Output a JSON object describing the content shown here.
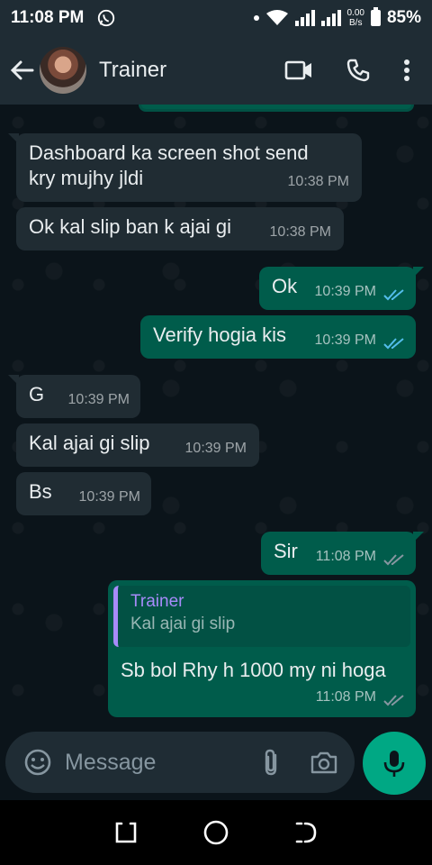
{
  "status": {
    "time": "11:08 PM",
    "net_speed_value": "0.00",
    "net_speed_unit": "B/s",
    "battery": "85%"
  },
  "header": {
    "contact_name": "Trainer"
  },
  "messages": [
    {
      "direction": "in",
      "text_line1": "Dashboard ka screen shot send",
      "text_line2": "kry mujhy jldi",
      "time": "10:38 PM"
    },
    {
      "direction": "in",
      "text": "Ok kal slip ban k ajai gi",
      "time": "10:38 PM"
    },
    {
      "direction": "out",
      "text": "Ok",
      "time": "10:39 PM",
      "status": "read"
    },
    {
      "direction": "out",
      "text": "Verify hogia kis",
      "time": "10:39 PM",
      "status": "read"
    },
    {
      "direction": "in",
      "text": "G",
      "time": "10:39 PM"
    },
    {
      "direction": "in",
      "text": "Kal ajai gi slip",
      "time": "10:39 PM"
    },
    {
      "direction": "in",
      "text": "Bs",
      "time": "10:39 PM"
    },
    {
      "direction": "out",
      "text": "Sir",
      "time": "11:08 PM",
      "status": "delivered"
    },
    {
      "direction": "out",
      "text": "Sb bol Rhy h 1000 my ni hoga",
      "time": "11:08 PM",
      "status": "delivered",
      "quoted": {
        "name": "Trainer",
        "text": "Kal ajai gi slip"
      }
    }
  ],
  "composer": {
    "placeholder": "Message"
  },
  "colors": {
    "outgoing_bubble": "#005c4b",
    "incoming_bubble": "#202c33",
    "read_tick": "#53bdeb",
    "delivered_tick": "#8696a0",
    "accent": "#00a884",
    "quote_accent": "#a78bfa"
  },
  "icons": [
    "whatsapp-icon",
    "wifi-icon",
    "signal-icon",
    "battery-icon",
    "back-arrow-icon",
    "video-call-icon",
    "voice-call-icon",
    "more-options-icon",
    "emoji-icon",
    "attachment-icon",
    "camera-icon",
    "microphone-icon",
    "recents-icon",
    "home-icon",
    "back-nav-icon"
  ]
}
